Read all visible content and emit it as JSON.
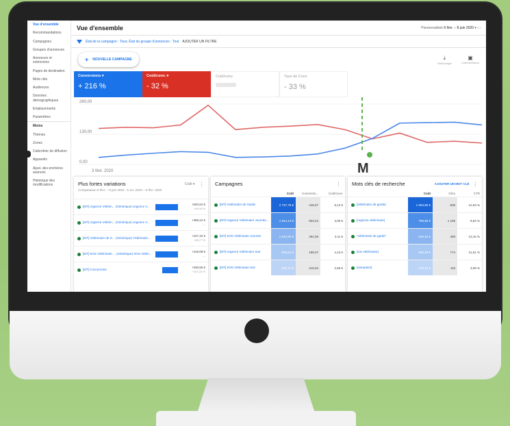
{
  "sidebar": {
    "items": [
      {
        "label": "Vue d'ensemble"
      },
      {
        "label": "Recommandations"
      },
      {
        "label": "Campagnes"
      },
      {
        "label": "Groupes d'annonces"
      },
      {
        "label": "Annonces et extensions"
      },
      {
        "label": "Pages de destination"
      },
      {
        "label": "Mots clés"
      },
      {
        "label": "Audiences"
      },
      {
        "label": "Données démographiques"
      },
      {
        "label": "Emplacements"
      },
      {
        "label": "Paramètres"
      },
      {
        "label": "Moins"
      },
      {
        "label": "Thèmes"
      },
      {
        "label": "Zones"
      },
      {
        "label": "Calendrier de diffusion"
      },
      {
        "label": "Appareils"
      },
      {
        "label": "Ajust. des enchères avancés"
      },
      {
        "label": "Historique des modifications"
      }
    ]
  },
  "header": {
    "title": "Vue d'ensemble",
    "period_label": "Personnalisée",
    "period_value": "6 févr. – 8 juin 2020"
  },
  "filter": {
    "text": "État de la campagne : Tous; État du groupe d'annonces : Tout",
    "add_label": "AJOUTER UN FILTRE"
  },
  "actions": {
    "new_campaign": "NOUVELLE CAMPAGNE",
    "download": "Télécharger",
    "feedback": "Commentaires"
  },
  "scorecards": [
    {
      "label": "Conversions ▾",
      "value": "+ 216 %"
    },
    {
      "label": "Coût/conv. ▾",
      "value": "- 32 %"
    },
    {
      "label": "Coût/conv.",
      "value": ""
    },
    {
      "label": "Taux de Conv",
      "value": "- 33 %"
    }
  ],
  "chart_data": {
    "type": "line",
    "x": [
      "3 févr. 2020"
    ],
    "ylim": [
      0,
      260
    ],
    "yticks": [
      "260,00",
      "130,00",
      "0,00"
    ],
    "series": [
      {
        "color": "#e06666",
        "values": [
          155,
          160,
          158,
          170,
          255,
          150,
          160,
          165,
          172,
          150,
          110,
          135,
          95,
          100,
          92
        ]
      },
      {
        "color": "#4a86e8",
        "values": [
          30,
          40,
          48,
          55,
          52,
          30,
          32,
          36,
          45,
          70,
          112,
          178,
          180,
          182,
          170
        ]
      }
    ],
    "colors": {
      "series1": "#e06666",
      "series2": "#4a86e8",
      "marker": "#5ab34a"
    }
  },
  "logo": {
    "text": "M"
  },
  "variations": {
    "title": "Plus fortes variations",
    "metric": "Coût ▾",
    "subtitle": "Comparaison 6 févr. – 8 juin 2020 - 5 oct. 2019 – 6 févr. 2020",
    "rows": [
      {
        "name": "[MT] Urgence Vétérin... (Générique) Urgence V...",
        "amount": "+520,64 €",
        "delta": "+90,16 %",
        "fill": 0.78
      },
      {
        "name": "[MT] Urgence Vétérin... (Générique) Urgence V...",
        "amount": "+459,12 €",
        "delta": "—",
        "fill": 0.78
      },
      {
        "name": "[MT] Vétérinaire de G... (Générique) Vétérinaire...",
        "amount": "+447,42 €",
        "delta": "+28,77 %",
        "fill": 0.78
      },
      {
        "name": "[MT] SOS Vétérinaire ... (Générique) SOS Vétéri...",
        "amount": "+419,08 €",
        "delta": "—",
        "fill": 0.78
      },
      {
        "name": "[MT] Concurrents",
        "amount": "+330,56 €",
        "delta": "+137,22 %",
        "fill": 0.55
      }
    ]
  },
  "campaigns": {
    "title": "Campagnes",
    "headers": [
      "Coût",
      "Conversio...",
      "Coût/conv."
    ],
    "rows": [
      {
        "name": "[MT] Vétérinaire de Garde",
        "cost": "2 737,78 €",
        "conv": "445,97",
        "cpc": "6,14 €",
        "shade": "#1a66d9"
      },
      {
        "name": "[MT] Urgence Vétérinaire Journée...",
        "cost": "1 844,14 €",
        "conv": "603,24",
        "cpc": "3,00 €",
        "shade": "#4d8ee8"
      },
      {
        "name": "[MT] SOS Vétérinaire Journée",
        "cost": "1 043,20 €",
        "conv": "494,39",
        "cpc": "2,11 €",
        "shade": "#8ab5f0"
      },
      {
        "name": "[MT] Urgence Vétérinaire Soir",
        "cost": "819,64 €",
        "conv": "198,07",
        "cpc": "4,13 €",
        "shade": "#a8c8f4"
      },
      {
        "name": "[MT] SOS Vétérinaire Soir",
        "cost": "615,72 €",
        "conv": "215,04",
        "cpc": "2,86 €",
        "shade": "#bcd5f6"
      }
    ]
  },
  "keywords": {
    "title": "Mots clés de recherche",
    "add_label": "AJOUTER UN MOT CLÉ",
    "headers": [
      "Coût",
      "Clics",
      "CTR"
    ],
    "rows": [
      {
        "name": "[vétérinaire de garde]",
        "cost": "1 094,86 €",
        "clicks": "609",
        "ctr": "12,63 %",
        "shade": "#1a66d9"
      },
      {
        "name": "[urgence vétérinaire]",
        "cost": "790,90 €",
        "clicks": "1 105",
        "ctr": "9,53 %",
        "shade": "#4d8ee8"
      },
      {
        "name": "\"vétérinaire de garde\"",
        "cost": "640,42 €",
        "clicks": "499",
        "ctr": "13,16 %",
        "shade": "#8ab5f0"
      },
      {
        "name": "[sos vétérinaire]",
        "cost": "500,29 €",
        "clicks": "774",
        "ctr": "21,51 %",
        "shade": "#a8c8f4"
      },
      {
        "name": "[vetoadom]",
        "cost": "375,13 €",
        "clicks": "118",
        "ctr": "3,09 %",
        "shade": "#bcd5f6"
      }
    ]
  }
}
